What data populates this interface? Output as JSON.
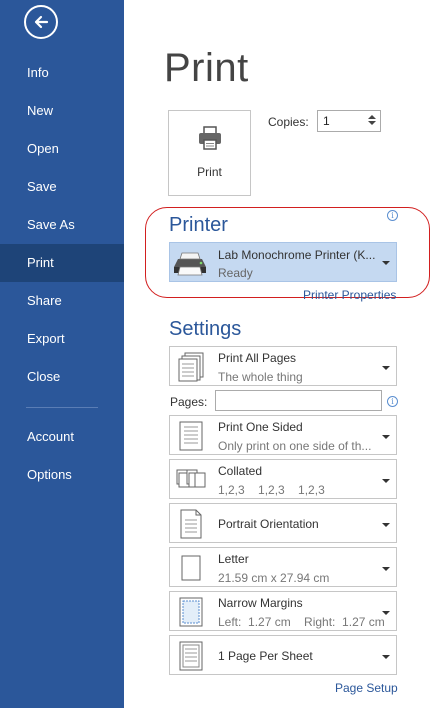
{
  "sidebar": {
    "back_icon": "back-arrow-icon",
    "items": [
      {
        "label": "Info"
      },
      {
        "label": "New"
      },
      {
        "label": "Open"
      },
      {
        "label": "Save"
      },
      {
        "label": "Save As"
      },
      {
        "label": "Print",
        "active": true
      },
      {
        "label": "Share"
      },
      {
        "label": "Export"
      },
      {
        "label": "Close"
      },
      {
        "label": "Account"
      },
      {
        "label": "Options"
      }
    ]
  },
  "main": {
    "title": "Print",
    "print_button_label": "Print",
    "copies_label": "Copies:",
    "copies_value": "1",
    "printer": {
      "section_title": "Printer",
      "name": "Lab Monochrome Printer (K...",
      "status": "Ready",
      "properties_link": "Printer Properties"
    },
    "settings": {
      "section_title": "Settings",
      "pages_label": "Pages:",
      "pages_value": "",
      "items": [
        {
          "line1": "Print All Pages",
          "line2": "The whole thing",
          "icon": "pages-icon"
        },
        {
          "line1": "Print One Sided",
          "line2": "Only print on one side of th...",
          "icon": "one-sided-icon"
        },
        {
          "line1": "Collated",
          "line2": "1,2,3    1,2,3    1,2,3",
          "icon": "collated-icon"
        },
        {
          "line1": "Portrait Orientation",
          "line2": "",
          "icon": "portrait-icon"
        },
        {
          "line1": "Letter",
          "line2": "21.59 cm x 27.94 cm",
          "icon": "paper-size-icon"
        },
        {
          "line1": "Narrow Margins",
          "line2": "Left:  1.27 cm    Right:  1.27 cm",
          "icon": "margins-icon"
        },
        {
          "line1": "1 Page Per Sheet",
          "line2": "",
          "icon": "pages-per-sheet-icon"
        }
      ],
      "page_setup_link": "Page Setup"
    }
  },
  "colors": {
    "sidebar_bg": "#2b579a",
    "sidebar_active": "#1e4478",
    "accent": "#2b579a",
    "printer_selected_bg": "#c5d9f1",
    "highlight_ellipse": "#d21f1f"
  }
}
